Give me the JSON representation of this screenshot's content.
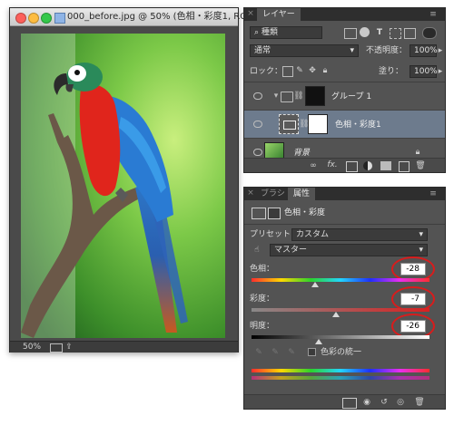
{
  "document": {
    "title": "000_before.jpg @ 50% (色相・彩度1, RGB...",
    "zoom": "50%"
  },
  "layers_panel": {
    "tab_label": "レイヤー",
    "filter_kind": "種類",
    "blend_mode": "通常",
    "opacity_label": "不透明度：",
    "opacity_value": "100%",
    "lock_label": "ロック：",
    "fill_label": "塗り：",
    "fill_value": "100%",
    "layers": [
      {
        "name": "グループ 1",
        "type": "group",
        "selected": false
      },
      {
        "name": "色相・彩度1",
        "type": "adjustment",
        "selected": true
      },
      {
        "name": "背景",
        "type": "background",
        "selected": false
      }
    ],
    "footer_icons": [
      "link-icon",
      "fx-icon",
      "mask-icon",
      "adjustment-icon",
      "folder-icon",
      "new-layer-icon",
      "trash-icon"
    ]
  },
  "properties_panel": {
    "tabs": [
      "ブラシ",
      "属性"
    ],
    "active_tab": "属性",
    "header": "色相・彩度",
    "preset_label": "プリセット：",
    "preset_value": "カスタム",
    "channel_value": "マスター",
    "hue_label": "色相：",
    "hue_value": "-28",
    "saturation_label": "彩度：",
    "saturation_value": "-7",
    "lightness_label": "明度：",
    "lightness_value": "-26",
    "colorize_label": "色彩の統一",
    "colorize_checked": false
  },
  "highlight_color": "#d81c1c"
}
